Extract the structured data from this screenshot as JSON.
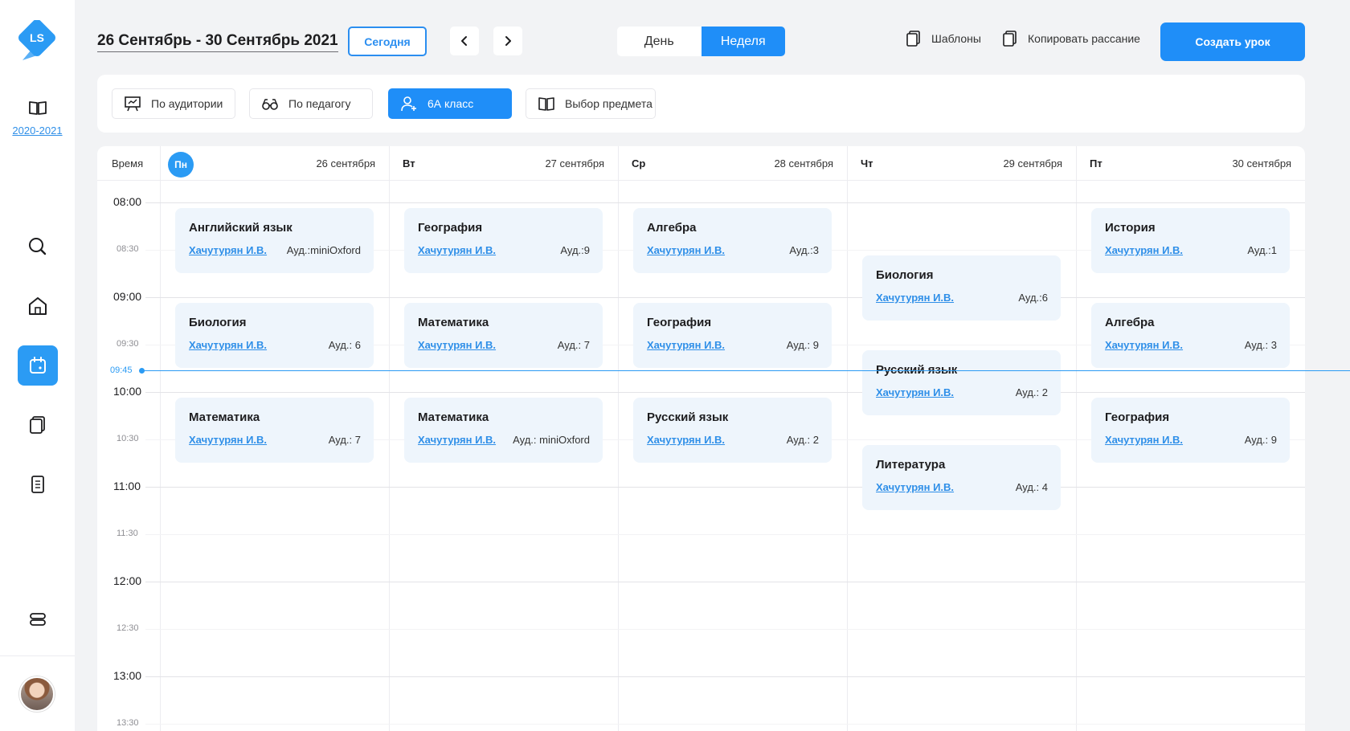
{
  "sidebar": {
    "logo_text": "LS",
    "academic_year": "2020-2021",
    "nav": [
      "search-icon",
      "home-icon",
      "calendar-icon",
      "documents-icon",
      "notebook-icon",
      "storage-icon"
    ]
  },
  "header": {
    "date_range": "26 Сентябрь - 30 Сентябрь 2021",
    "today_label": "Сегодня",
    "view_day": "День",
    "view_week": "Неделя",
    "templates_label": "Шаблоны",
    "copy_schedule_label": "Копировать рассание",
    "create_lesson_label": "Создать урок"
  },
  "filters": {
    "by_room": "По аудитории",
    "by_teacher": "По педагогу",
    "class": "6А класс",
    "subject": "Выбор предмета"
  },
  "calendar": {
    "time_header": "Время",
    "days": [
      {
        "abbr": "Пн",
        "date": "26 сентября",
        "today": true
      },
      {
        "abbr": "Вт",
        "date": "27 сентября"
      },
      {
        "abbr": "Ср",
        "date": "28 сентября"
      },
      {
        "abbr": "Чт",
        "date": "29 сентября"
      },
      {
        "abbr": "Пт",
        "date": "30 сентября"
      }
    ],
    "times": [
      "08:00",
      "08:30",
      "09:00",
      "09:30",
      "10:00",
      "10:30",
      "11:00",
      "11:30",
      "12:00",
      "12:30",
      "13:00",
      "13:30"
    ],
    "current_time": "09:45",
    "lessons": [
      {
        "day": 0,
        "start": "08:00",
        "subject": "Английский язык",
        "teacher": "Хачутурян И.В.",
        "room": "Ауд.:miniOxford"
      },
      {
        "day": 0,
        "start": "09:00",
        "subject": "Биология",
        "teacher": "Хачутурян И.В.",
        "room": "Ауд.: 6"
      },
      {
        "day": 0,
        "start": "10:00",
        "subject": "Математика",
        "teacher": "Хачутурян И.В.",
        "room": "Ауд.: 7"
      },
      {
        "day": 1,
        "start": "08:00",
        "subject": "География",
        "teacher": "Хачутурян И.В.",
        "room": "Ауд.:9"
      },
      {
        "day": 1,
        "start": "09:00",
        "subject": "Математика",
        "teacher": "Хачутурян И.В.",
        "room": "Ауд.: 7"
      },
      {
        "day": 1,
        "start": "10:00",
        "subject": "Математика",
        "teacher": "Хачутурян И.В.",
        "room": "Ауд.: miniOxford"
      },
      {
        "day": 2,
        "start": "08:00",
        "subject": "Алгебра",
        "teacher": "Хачутурян И.В.",
        "room": "Ауд.:3"
      },
      {
        "day": 2,
        "start": "09:00",
        "subject": "География",
        "teacher": "Хачутурян И.В.",
        "room": "Ауд.: 9"
      },
      {
        "day": 2,
        "start": "10:00",
        "subject": "Русский язык",
        "teacher": "Хачутурян И.В.",
        "room": "Ауд.: 2"
      },
      {
        "day": 3,
        "start": "08:30",
        "subject": "Биология",
        "teacher": "Хачутурян И.В.",
        "room": "Ауд.:6"
      },
      {
        "day": 3,
        "start": "09:30",
        "subject": "Русский язык",
        "teacher": "Хачутурян И.В.",
        "room": "Ауд.: 2"
      },
      {
        "day": 3,
        "start": "10:30",
        "subject": "Литература",
        "teacher": "Хачутурян И.В.",
        "room": "Ауд.: 4"
      },
      {
        "day": 4,
        "start": "08:00",
        "subject": "История",
        "teacher": "Хачутурян И.В.",
        "room": "Ауд.:1"
      },
      {
        "day": 4,
        "start": "09:00",
        "subject": "Алгебра",
        "teacher": "Хачутурян И.В.",
        "room": "Ауд.: 3"
      },
      {
        "day": 4,
        "start": "10:00",
        "subject": "География",
        "teacher": "Хачутурян И.В.",
        "room": "Ауд.: 9"
      }
    ]
  },
  "colors": {
    "accent": "#1f8ef8",
    "lesson_bg": "#eef5fc",
    "link": "#2f8fe8",
    "page_bg": "#f2f3f5"
  }
}
